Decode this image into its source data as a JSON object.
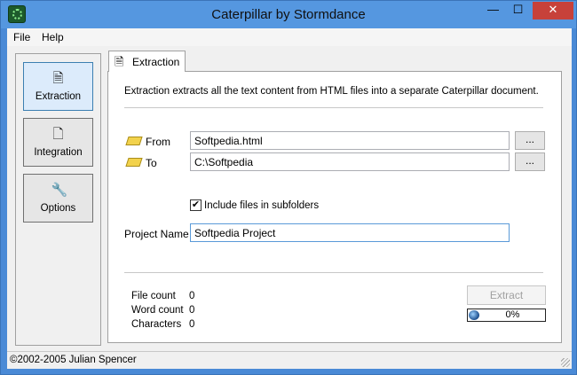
{
  "window": {
    "title": "Caterpillar by Stormdance",
    "minimize_glyph": "—",
    "maximize_glyph": "☐",
    "close_glyph": "✕"
  },
  "menu": {
    "file": "File",
    "help": "Help"
  },
  "sidebar": {
    "items": [
      {
        "label": "Extraction",
        "icon": "document-arrow-icon"
      },
      {
        "label": "Integration",
        "icon": "document-plus-icon"
      },
      {
        "label": "Options",
        "icon": "wrench-icon"
      }
    ]
  },
  "tab": {
    "label": "Extraction",
    "icon": "document-arrow-icon"
  },
  "extraction": {
    "description": "Extraction extracts all the text content from HTML files into a separate Caterpillar document.",
    "from_label": "From",
    "from_value": "Softpedia.html",
    "to_label": "To",
    "to_value": "C:\\Softpedia",
    "browse_label": "...",
    "include_subfolders_label": "Include files in subfolders",
    "include_subfolders_checked": true,
    "project_name_label": "Project Name",
    "project_name_value": "Softpedia Project"
  },
  "stats": {
    "file_count_label": "File count",
    "file_count": "0",
    "word_count_label": "Word count",
    "word_count": "0",
    "characters_label": "Characters",
    "characters": "0"
  },
  "actions": {
    "extract_label": "Extract"
  },
  "progress": {
    "value": 0,
    "text": "0%"
  },
  "status": {
    "text": "©2002-2005 Julian Spencer"
  },
  "colors": {
    "titlebar": "#5597e0",
    "close_button": "#c7413a",
    "accent": "#3c7fb1"
  }
}
